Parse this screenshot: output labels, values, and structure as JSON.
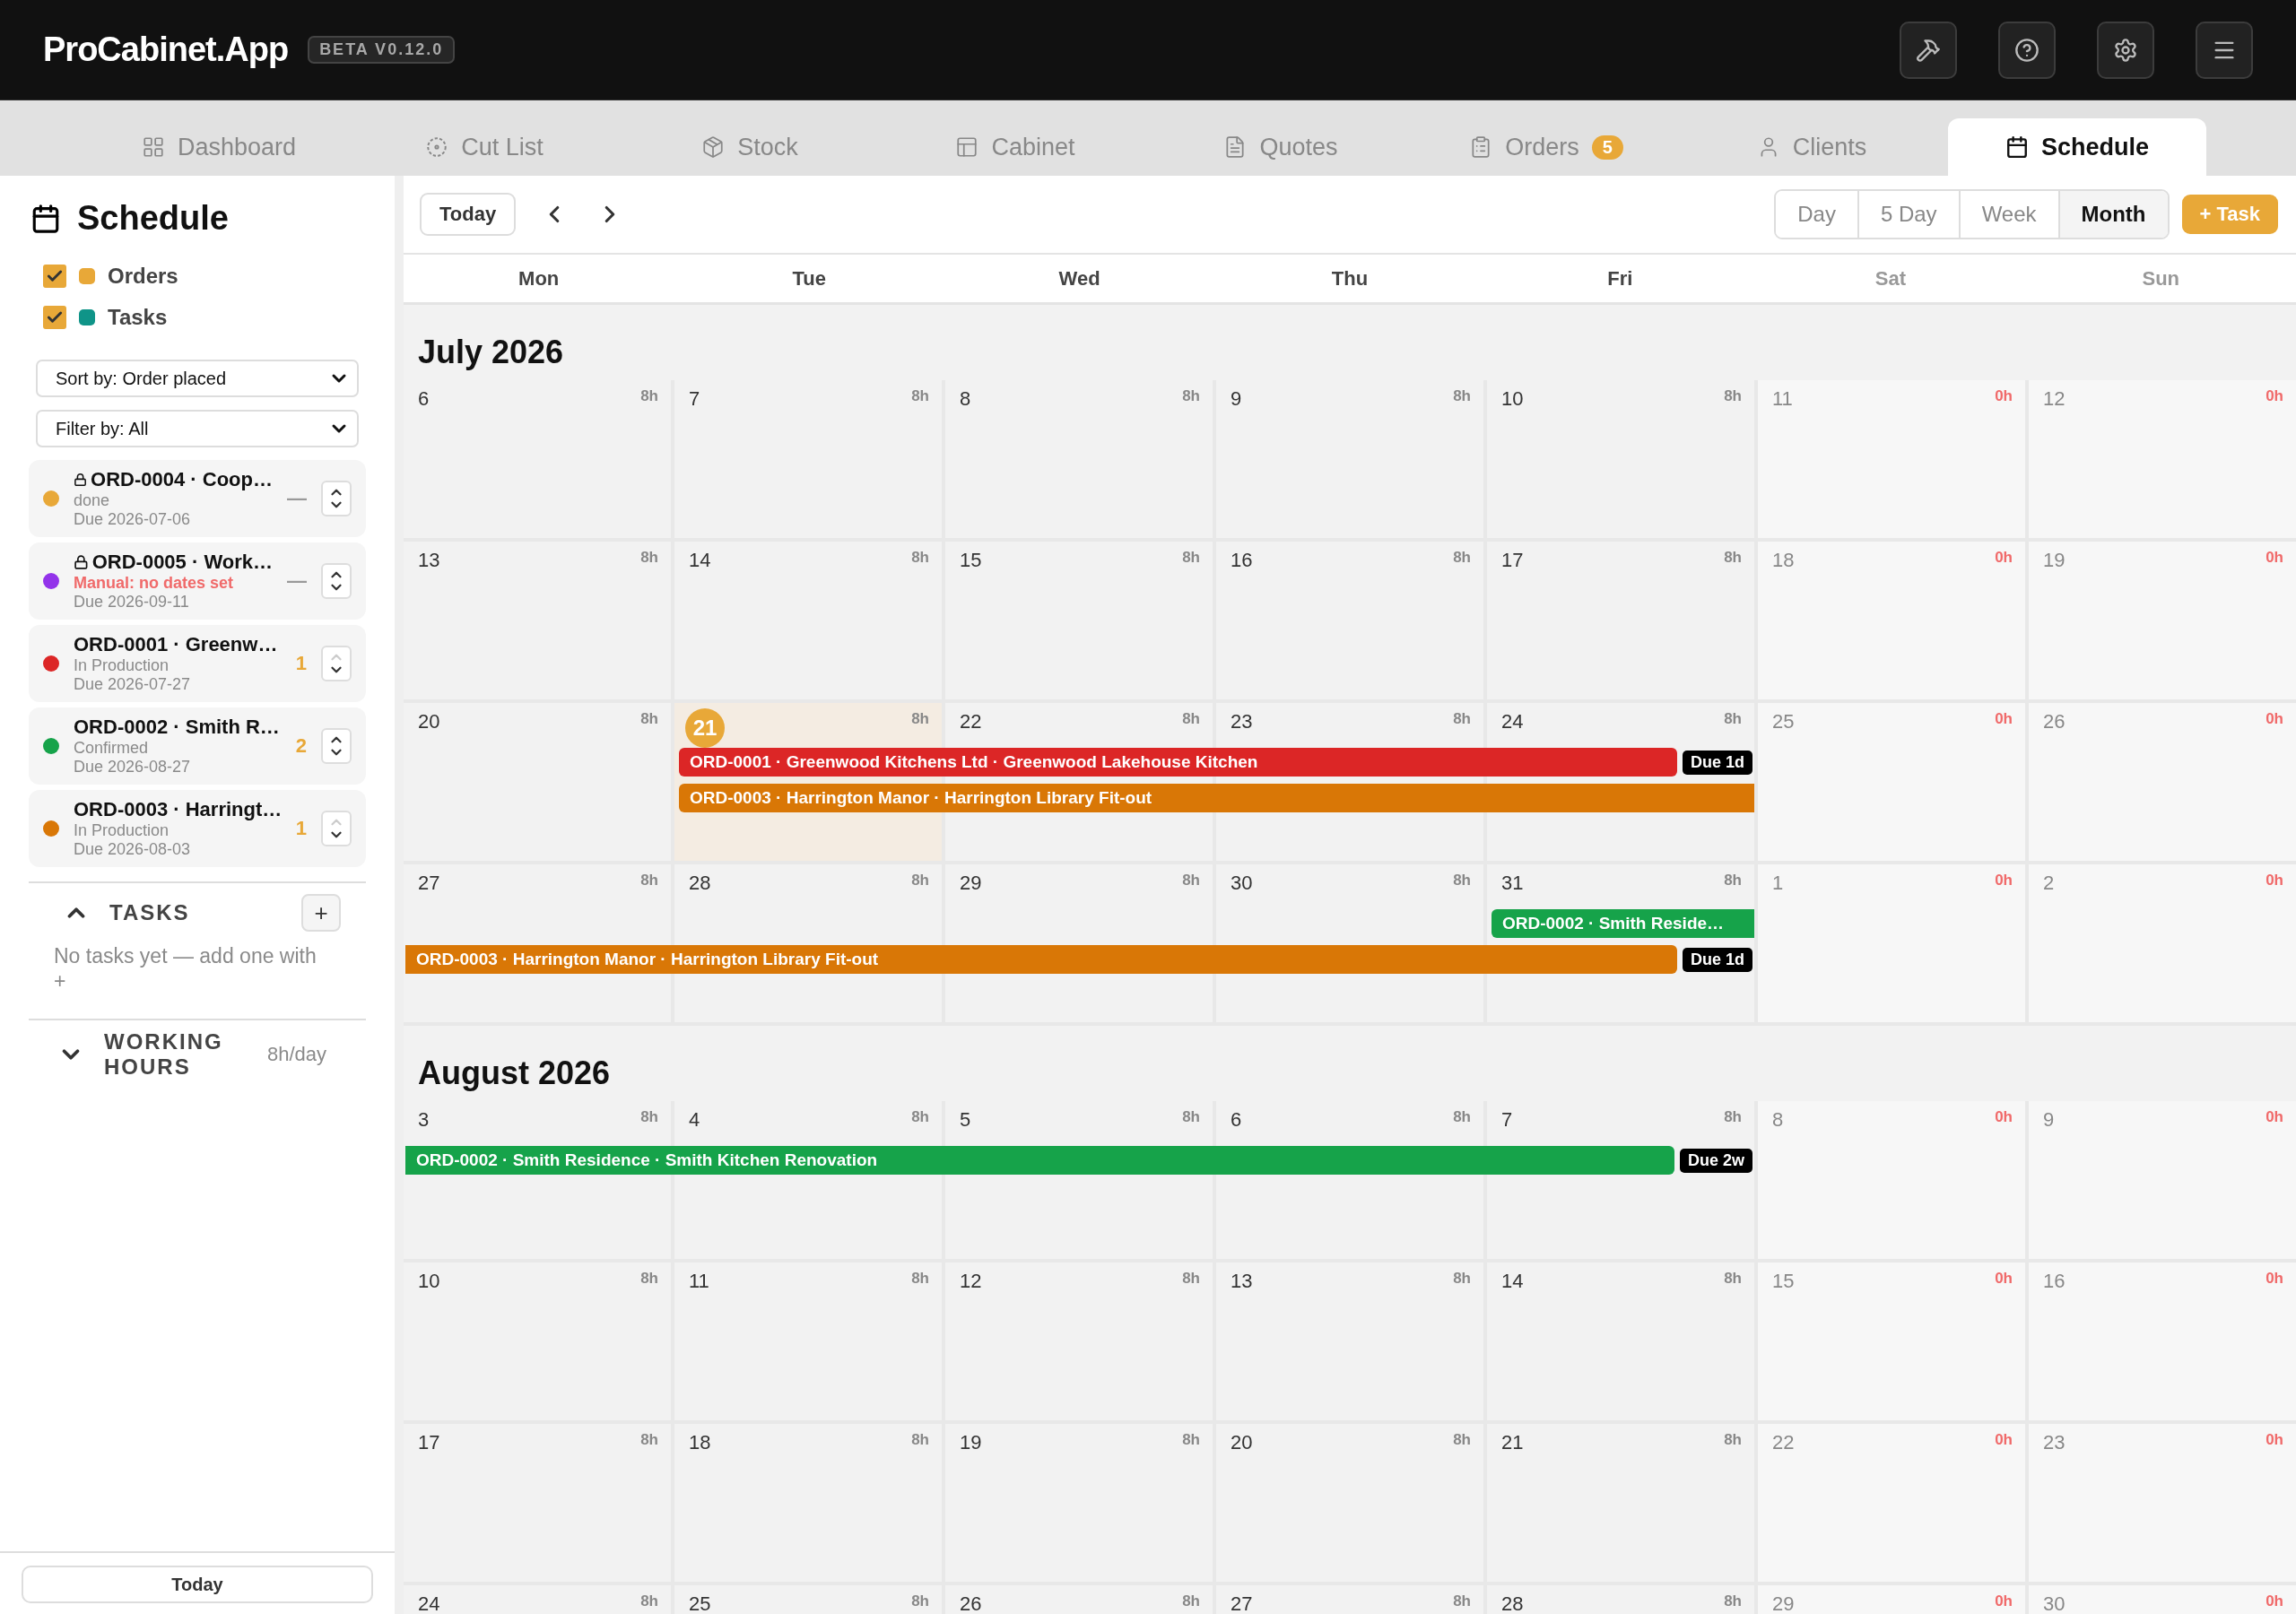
{
  "app": {
    "name": "ProCabinet.App",
    "version_badge": "BETA V0.12.0"
  },
  "nav_tabs": [
    {
      "label": "Dashboard",
      "selected": false
    },
    {
      "label": "Cut List",
      "selected": false
    },
    {
      "label": "Stock",
      "selected": false
    },
    {
      "label": "Cabinet",
      "selected": false
    },
    {
      "label": "Quotes",
      "selected": false
    },
    {
      "label": "Orders",
      "selected": false,
      "badge": "5"
    },
    {
      "label": "Clients",
      "selected": false
    },
    {
      "label": "Schedule",
      "selected": true
    }
  ],
  "sidebar": {
    "title": "Schedule",
    "layers": [
      {
        "label": "Orders",
        "checked": true,
        "color": "#e8a838"
      },
      {
        "label": "Tasks",
        "checked": true,
        "color": "#0f9488"
      }
    ],
    "sort_select": "Sort by: Order placed",
    "filter_select": "Filter by: All",
    "orders": [
      {
        "title": "ORD-0004 · Coop…",
        "locked": true,
        "status": "done",
        "warning": false,
        "due": "Due 2026-07-06",
        "color": "#e8a838",
        "priority": "—",
        "ranked": false,
        "up_disabled": false
      },
      {
        "title": "ORD-0005 · Work…",
        "locked": true,
        "status": "Manual: no dates set",
        "warning": true,
        "due": "Due 2026-09-11",
        "color": "#9333ea",
        "priority": "—",
        "ranked": false,
        "up_disabled": false
      },
      {
        "title": "ORD-0001 · Greenw…",
        "locked": false,
        "status": "In Production",
        "warning": false,
        "due": "Due 2026-07-27",
        "color": "#dc2626",
        "priority": "1",
        "ranked": true,
        "up_disabled": true
      },
      {
        "title": "ORD-0002 · Smith R…",
        "locked": false,
        "status": "Confirmed",
        "warning": false,
        "due": "Due 2026-08-27",
        "color": "#16a34a",
        "priority": "2",
        "ranked": true,
        "up_disabled": false
      },
      {
        "title": "ORD-0003 · Harringt…",
        "locked": false,
        "status": "In Production",
        "warning": false,
        "due": "Due 2026-08-03",
        "color": "#d97706",
        "priority": "1",
        "ranked": true,
        "up_disabled": true
      }
    ],
    "tasks": {
      "heading": "TASKS",
      "expanded": true,
      "add_button": "+",
      "empty_text": "No tasks yet — add one with +"
    },
    "working_hours": {
      "heading": "WORKING HOURS",
      "expanded": false,
      "value": "8h/day"
    },
    "footer_button": "Today"
  },
  "toolbar": {
    "today_button": "Today",
    "views": [
      {
        "label": "Day",
        "selected": false
      },
      {
        "label": "5 Day",
        "selected": false
      },
      {
        "label": "Week",
        "selected": false
      },
      {
        "label": "Month",
        "selected": true
      }
    ],
    "add_task_button": "+ Task"
  },
  "weekdays": [
    {
      "label": "Mon",
      "weekend": false
    },
    {
      "label": "Tue",
      "weekend": false
    },
    {
      "label": "Wed",
      "weekend": false
    },
    {
      "label": "Thu",
      "weekend": false
    },
    {
      "label": "Fri",
      "weekend": false
    },
    {
      "label": "Sat",
      "weekend": true
    },
    {
      "label": "Sun",
      "weekend": true
    }
  ],
  "months": [
    {
      "title": "July 2026",
      "weeks": [
        {
          "days": [
            {
              "day": "6",
              "hours": "8h",
              "off": false,
              "today": false
            },
            {
              "day": "7",
              "hours": "8h",
              "off": false,
              "today": false
            },
            {
              "day": "8",
              "hours": "8h",
              "off": false,
              "today": false
            },
            {
              "day": "9",
              "hours": "8h",
              "off": false,
              "today": false
            },
            {
              "day": "10",
              "hours": "8h",
              "off": false,
              "today": false
            },
            {
              "day": "11",
              "hours": "0h",
              "off": true,
              "today": false
            },
            {
              "day": "12",
              "hours": "0h",
              "off": true,
              "today": false
            }
          ]
        },
        {
          "days": [
            {
              "day": "13",
              "hours": "8h",
              "off": false,
              "today": false
            },
            {
              "day": "14",
              "hours": "8h",
              "off": false,
              "today": false
            },
            {
              "day": "15",
              "hours": "8h",
              "off": false,
              "today": false
            },
            {
              "day": "16",
              "hours": "8h",
              "off": false,
              "today": false
            },
            {
              "day": "17",
              "hours": "8h",
              "off": false,
              "today": false
            },
            {
              "day": "18",
              "hours": "0h",
              "off": true,
              "today": false
            },
            {
              "day": "19",
              "hours": "0h",
              "off": true,
              "today": false
            }
          ]
        },
        {
          "days": [
            {
              "day": "20",
              "hours": "8h",
              "off": false,
              "today": false
            },
            {
              "day": "21",
              "hours": "8h",
              "off": false,
              "today": true,
              "events": [
                {
                  "label": "ORD-0001 · Greenwood Kitchens Ltd · Greenwood Lakehouse Kitchen",
                  "color": "#dc2626",
                  "continued": false,
                  "continues": false,
                  "due": "Due 1d"
                },
                {
                  "label": "ORD-0003 · Harrington Manor · Harrington Library Fit-out",
                  "color": "#d97706",
                  "continued": false,
                  "continues": true
                }
              ]
            },
            {
              "day": "22",
              "hours": "8h",
              "off": false,
              "today": false
            },
            {
              "day": "23",
              "hours": "8h",
              "off": false,
              "today": false
            },
            {
              "day": "24",
              "hours": "8h",
              "off": false,
              "today": false
            },
            {
              "day": "25",
              "hours": "0h",
              "off": true,
              "today": false
            },
            {
              "day": "26",
              "hours": "0h",
              "off": true,
              "today": false
            }
          ]
        },
        {
          "days": [
            {
              "day": "27",
              "hours": "8h",
              "off": false,
              "today": false,
              "events": [
                {
                  "label": "ORD-0003 · Harrington Manor · Harrington Library Fit-out",
                  "color": "#d97706",
                  "continued": true,
                  "continues": false,
                  "due": "Due 1d"
                }
              ]
            },
            {
              "day": "28",
              "hours": "8h",
              "off": false,
              "today": false
            },
            {
              "day": "29",
              "hours": "8h",
              "off": false,
              "today": false
            },
            {
              "day": "30",
              "hours": "8h",
              "off": false,
              "today": false
            },
            {
              "day": "31",
              "hours": "8h",
              "off": false,
              "today": false,
              "events": [
                {
                  "label": "ORD-0002 · Smith Reside…",
                  "color": "#16a34a",
                  "continued": false,
                  "continues": true
                }
              ]
            },
            {
              "day": "1",
              "hours": "0h",
              "off": true,
              "today": false
            },
            {
              "day": "2",
              "hours": "0h",
              "off": true,
              "today": false
            }
          ]
        }
      ]
    },
    {
      "title": "August 2026",
      "weeks": [
        {
          "days": [
            {
              "day": "3",
              "hours": "8h",
              "off": false,
              "today": false,
              "events": [
                {
                  "label": "ORD-0002 · Smith Residence · Smith Kitchen Renovation",
                  "color": "#16a34a",
                  "continued": true,
                  "continues": false,
                  "due": "Due 2w"
                }
              ]
            },
            {
              "day": "4",
              "hours": "8h",
              "off": false,
              "today": false
            },
            {
              "day": "5",
              "hours": "8h",
              "off": false,
              "today": false
            },
            {
              "day": "6",
              "hours": "8h",
              "off": false,
              "today": false
            },
            {
              "day": "7",
              "hours": "8h",
              "off": false,
              "today": false
            },
            {
              "day": "8",
              "hours": "0h",
              "off": true,
              "today": false
            },
            {
              "day": "9",
              "hours": "0h",
              "off": true,
              "today": false
            }
          ]
        },
        {
          "days": [
            {
              "day": "10",
              "hours": "8h",
              "off": false,
              "today": false
            },
            {
              "day": "11",
              "hours": "8h",
              "off": false,
              "today": false
            },
            {
              "day": "12",
              "hours": "8h",
              "off": false,
              "today": false
            },
            {
              "day": "13",
              "hours": "8h",
              "off": false,
              "today": false
            },
            {
              "day": "14",
              "hours": "8h",
              "off": false,
              "today": false
            },
            {
              "day": "15",
              "hours": "0h",
              "off": true,
              "today": false
            },
            {
              "day": "16",
              "hours": "0h",
              "off": true,
              "today": false
            }
          ]
        },
        {
          "days": [
            {
              "day": "17",
              "hours": "8h",
              "off": false,
              "today": false
            },
            {
              "day": "18",
              "hours": "8h",
              "off": false,
              "today": false
            },
            {
              "day": "19",
              "hours": "8h",
              "off": false,
              "today": false
            },
            {
              "day": "20",
              "hours": "8h",
              "off": false,
              "today": false
            },
            {
              "day": "21",
              "hours": "8h",
              "off": false,
              "today": false
            },
            {
              "day": "22",
              "hours": "0h",
              "off": true,
              "today": false
            },
            {
              "day": "23",
              "hours": "0h",
              "off": true,
              "today": false
            }
          ]
        },
        {
          "days": [
            {
              "day": "24",
              "hours": "8h",
              "off": false,
              "today": false
            },
            {
              "day": "25",
              "hours": "8h",
              "off": false,
              "today": false
            },
            {
              "day": "26",
              "hours": "8h",
              "off": false,
              "today": false
            },
            {
              "day": "27",
              "hours": "8h",
              "off": false,
              "today": false
            },
            {
              "day": "28",
              "hours": "8h",
              "off": false,
              "today": false
            },
            {
              "day": "29",
              "hours": "0h",
              "off": true,
              "today": false
            },
            {
              "day": "30",
              "hours": "0h",
              "off": true,
              "today": false
            }
          ]
        }
      ]
    }
  ]
}
